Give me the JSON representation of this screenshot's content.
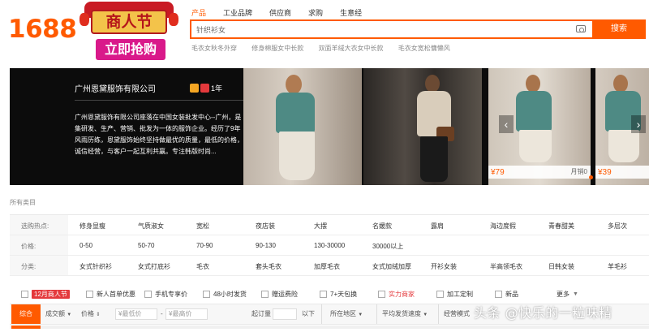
{
  "header": {
    "logo": "1688",
    "promo": {
      "title": "商人节",
      "button": "立即抢购"
    },
    "tabs": [
      "产品",
      "工业品牌",
      "供应商",
      "求购",
      "生意经"
    ],
    "search": {
      "value": "针织衫女",
      "button": "搜索"
    },
    "hotwords": [
      "毛衣女秋冬外穿",
      "修身棉服女中长款",
      "双面羊绒大衣女中长款",
      "毛衣女宽松慵懒风"
    ]
  },
  "banner": {
    "company": "广州恩黛服饰有限公司",
    "years": "1年",
    "description": "广州恩黛服饰有限公司座落在中国女装批发中心--广州，是集研发、生产、营销、批发为一体的服饰企业。经历了9年风雨历练，恩黛服饰始终坚持做最优的质量，最低的价格，诚信经营，与客户一起互利共赢。专注韩版时尚...",
    "products": [
      {
        "price": "¥79",
        "sales": "月销0"
      },
      {
        "price": "¥39",
        "sales": ""
      }
    ],
    "prev": "‹",
    "next": "›"
  },
  "all_categories": "所有类目",
  "filters": [
    {
      "label": "选购热点:",
      "options": [
        "修身显瘦",
        "气质淑女",
        "宽松",
        "夜店装",
        "大摆",
        "名媛款",
        "露肩",
        "海边度假",
        "青春甜美",
        "多层次"
      ]
    },
    {
      "label": "价格:",
      "options": [
        "0-50",
        "50-70",
        "70-90",
        "90-130",
        "130-30000",
        "30000以上"
      ]
    },
    {
      "label": "分类:",
      "options": [
        "女式针织衫",
        "女式打底衫",
        "毛衣",
        "套头毛衣",
        "加厚毛衣",
        "女式加绒加厚",
        "开衫女装",
        "半高领毛衣",
        "日韩女装",
        "羊毛衫"
      ]
    }
  ],
  "checks": {
    "tag": "12月商人节",
    "items": [
      "新人首单优惠",
      "手机专享价",
      "48小时发货",
      "赠运费险",
      "7+天包换",
      "实力商家",
      "加工定制",
      "新品"
    ],
    "more": "更多"
  },
  "sortbar": {
    "active": "综合",
    "volume": "成交额",
    "price": "价格",
    "min_price": "¥最低价",
    "max_price": "¥最高价",
    "moq": "起订量",
    "below": "以下",
    "region": "所在地区",
    "ship_speed": "平均发货速度",
    "business_mode": "经营模式"
  },
  "watermark": "头条 @快乐的一粒味精",
  "colors": {
    "accent": "#ff5a00",
    "promo_red": "#e4393c",
    "banner_bg": "#0c0c0c"
  }
}
